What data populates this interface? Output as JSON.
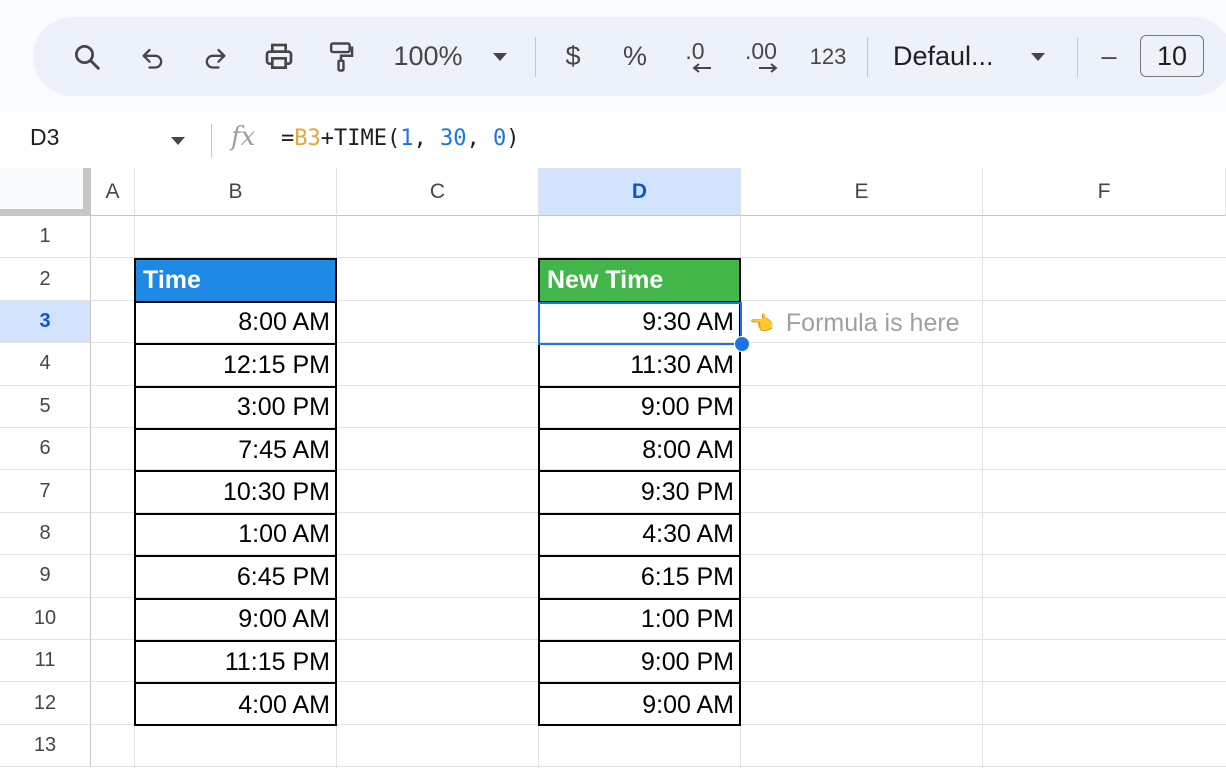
{
  "toolbar": {
    "icons": [
      "search-icon",
      "undo-icon",
      "redo-icon",
      "print-icon",
      "paint-format-icon"
    ],
    "zoom": "100%",
    "currency": "$",
    "percent": "%",
    "decrease_decimal": ".0",
    "increase_decimal": ".00",
    "more_formats": "123",
    "font": "Defaul...",
    "minus": "–",
    "font_size": "10"
  },
  "formula_bar": {
    "cell_ref": "D3",
    "fx": "fx",
    "formula_parts": {
      "eq": "=",
      "ref": "B3",
      "func": "+TIME(",
      "h": "1",
      "sep1": ", ",
      "m": "30",
      "sep2": ", ",
      "s": "0",
      "close": ")"
    }
  },
  "columns": [
    "A",
    "B",
    "C",
    "D",
    "E",
    "F"
  ],
  "selected_column": "D",
  "rows": [
    "1",
    "2",
    "3",
    "4",
    "5",
    "6",
    "7",
    "8",
    "9",
    "10",
    "11",
    "12",
    "13"
  ],
  "selected_row": "3",
  "table_b": {
    "header": "Time",
    "header_color": "#1e88e5",
    "values": [
      "8:00 AM",
      "12:15 PM",
      "3:00 PM",
      "7:45 AM",
      "10:30 PM",
      "1:00 AM",
      "6:45 PM",
      "9:00 AM",
      "11:15 PM",
      "4:00 AM"
    ]
  },
  "table_d": {
    "header": "New Time",
    "header_color": "#43b649",
    "values": [
      "9:30 AM",
      "11:30 AM",
      "9:00 PM",
      "8:00 AM",
      "9:30 PM",
      "4:30 AM",
      "6:15 PM",
      "1:00 PM",
      "9:00 PM",
      "9:00 AM"
    ]
  },
  "note": {
    "hand": "👈",
    "text": "Formula is here"
  }
}
